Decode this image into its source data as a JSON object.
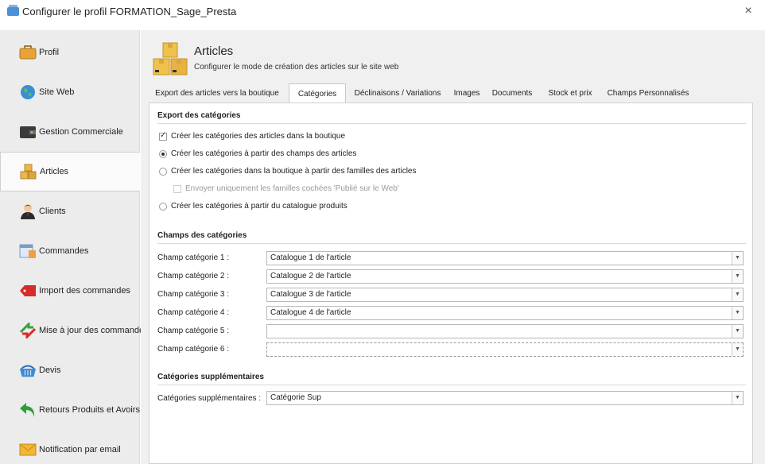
{
  "window": {
    "title": "Configurer le profil FORMATION_Sage_Presta",
    "close": "×"
  },
  "sidebar": {
    "items": [
      {
        "label": "Profil",
        "icon": "briefcase-icon"
      },
      {
        "label": "Site Web",
        "icon": "globe-icon"
      },
      {
        "label": "Gestion Commerciale",
        "icon": "wallet-icon"
      },
      {
        "label": "Articles",
        "icon": "boxes-icon"
      },
      {
        "label": "Clients",
        "icon": "user-icon"
      },
      {
        "label": "Commandes",
        "icon": "calendar-icon"
      },
      {
        "label": "Import des commandes",
        "icon": "sale-tag-icon"
      },
      {
        "label": "Mise à jour des commandes",
        "icon": "sync-arrows-icon"
      },
      {
        "label": "Devis",
        "icon": "basket-icon"
      },
      {
        "label": "Retours Produits et Avoirs",
        "icon": "return-arrow-icon"
      },
      {
        "label": "Notification par email",
        "icon": "email-icon"
      }
    ],
    "active_index": 3
  },
  "header": {
    "title": "Articles",
    "subtitle": "Configurer le mode de création des articles sur le site web"
  },
  "tabs": [
    {
      "label": "Export des articles vers la boutique"
    },
    {
      "label": "Catégories"
    },
    {
      "label": "Déclinaisons / Variations"
    },
    {
      "label": "Images"
    },
    {
      "label": "Documents"
    },
    {
      "label": "Stock et prix"
    },
    {
      "label": "Champs Personnalisés"
    }
  ],
  "active_tab": "Catégories",
  "export_section": {
    "title": "Export des catégories",
    "create_checkbox": "Créer les catégories des articles dans la boutique",
    "radio_fields": "Créer les catégories à partir des champs des articles",
    "radio_families": "Créer les catégories dans la boutique à partir des familles des articles",
    "send_checked_families": "Envoyer uniquement les familles cochées 'Publié sur le Web'",
    "radio_catalogue": "Créer les catégories à partir du catalogue produits"
  },
  "fields_section": {
    "title": "Champs des catégories",
    "rows": [
      {
        "label": "Champ catégorie 1 :",
        "value": "Catalogue 1 de l'article"
      },
      {
        "label": "Champ catégorie 2 :",
        "value": "Catalogue 2 de l'article"
      },
      {
        "label": "Champ catégorie 3 :",
        "value": "Catalogue 3 de l'article"
      },
      {
        "label": "Champ catégorie 4 :",
        "value": "Catalogue 4 de l'article"
      },
      {
        "label": "Champ catégorie 5 :",
        "value": ""
      },
      {
        "label": "Champ catégorie 6 :",
        "value": ""
      }
    ]
  },
  "extra_section": {
    "title": "Catégories supplémentaires",
    "label": "Catégories supplémentaires :",
    "value": "Catégorie Sup"
  },
  "colors": {
    "accent": "#4a90d9",
    "panel_bg": "#f0f0f0",
    "sidebar_bg": "#ececec"
  }
}
